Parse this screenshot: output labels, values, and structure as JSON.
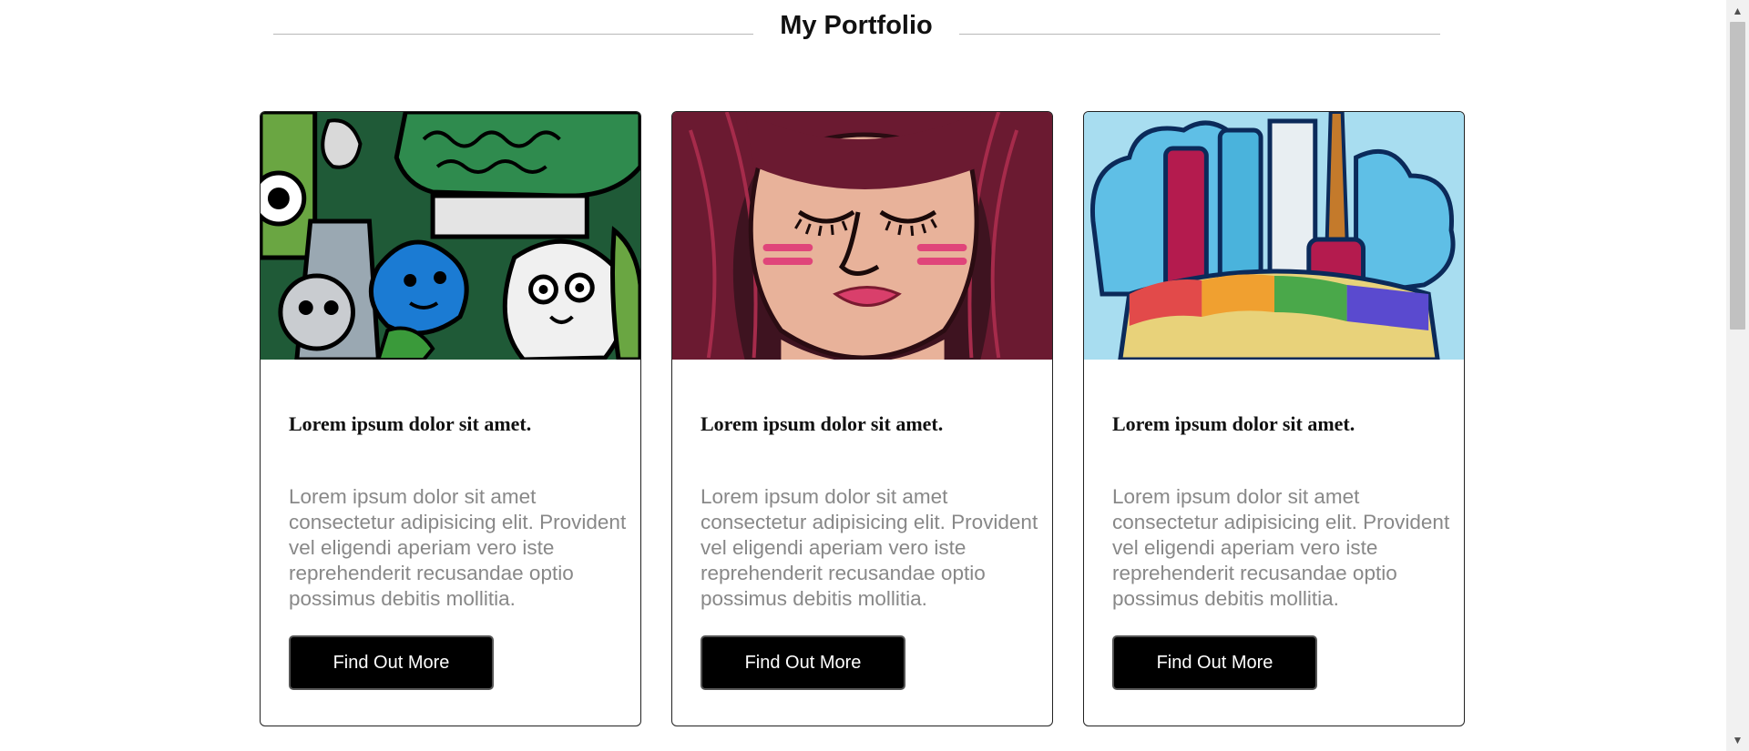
{
  "header": {
    "title": "My Portfolio"
  },
  "cards": [
    {
      "image": "doodle-creatures-illustration",
      "title": "Lorem ipsum dolor sit amet.",
      "text": "Lorem ipsum dolor sit amet consectetur adipisicing elit. Provident vel eligendi aperiam vero iste reprehenderit recusandae optio possimus debitis mollitia.",
      "button_label": "Find Out More"
    },
    {
      "image": "girl-face-illustration",
      "title": "Lorem ipsum dolor sit amet.",
      "text": "Lorem ipsum dolor sit amet consectetur adipisicing elit. Provident vel eligendi aperiam vero iste reprehenderit recusandae optio possimus debitis mollitia.",
      "button_label": "Find Out More"
    },
    {
      "image": "art-supplies-doodle-illustration",
      "title": "Lorem ipsum dolor sit amet.",
      "text": "Lorem ipsum dolor sit amet consectetur adipisicing elit. Provident vel eligendi aperiam vero iste reprehenderit recusandae optio possimus debitis mollitia.",
      "button_label": "Find Out More"
    }
  ],
  "colors": {
    "button_bg": "#000000",
    "button_text": "#ffffff",
    "body_text": "#888888",
    "divider": "#b8b8b8"
  },
  "scrollbar": {
    "up_icon": "scroll-up-arrow-icon",
    "down_icon": "scroll-down-arrow-icon"
  }
}
